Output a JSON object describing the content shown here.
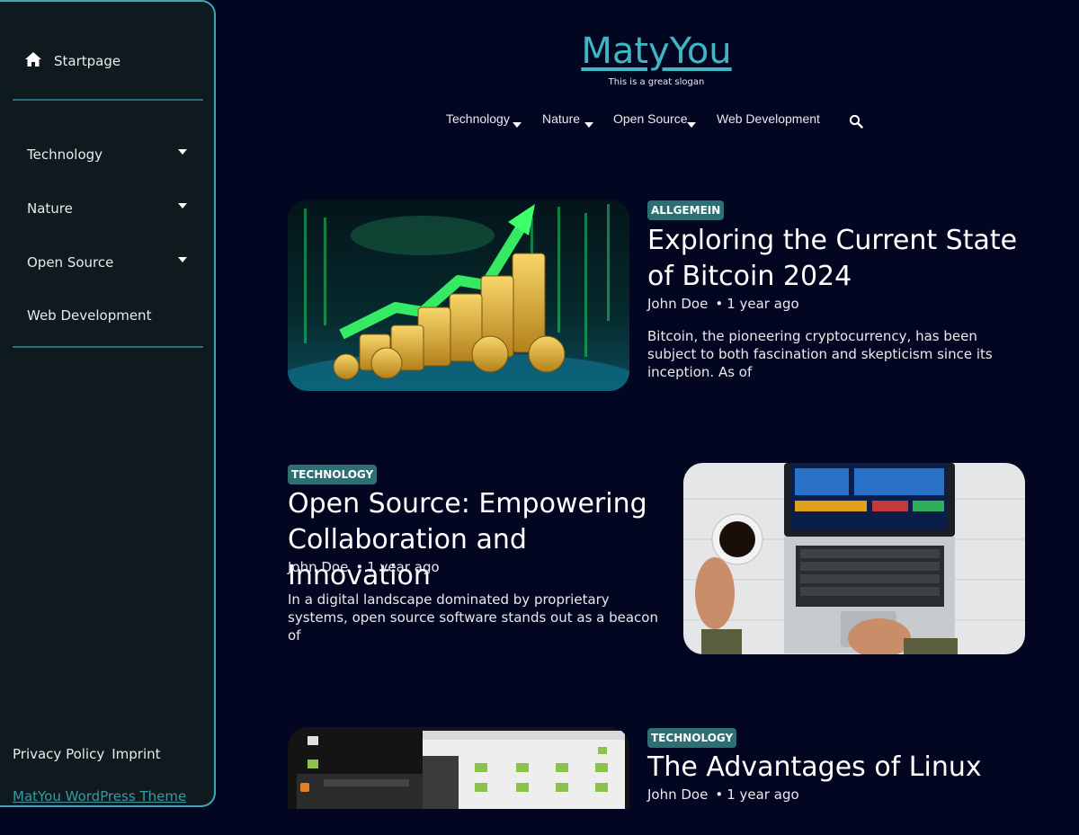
{
  "sidebar": {
    "startpage_label": "Startpage",
    "menu": [
      {
        "label": "Technology",
        "has_submenu": true
      },
      {
        "label": "Nature",
        "has_submenu": true
      },
      {
        "label": "Open Source",
        "has_submenu": true
      },
      {
        "label": "Web Development",
        "has_submenu": false
      }
    ],
    "footer_links": [
      "Privacy Policy",
      "Imprint"
    ],
    "theme_credit": "MatYou WordPress Theme"
  },
  "header": {
    "site_title": "MatyYou",
    "slogan": "This is a great slogan",
    "nav": [
      {
        "label": "Technology",
        "has_submenu": true
      },
      {
        "label": "Nature",
        "has_submenu": true
      },
      {
        "label": "Open Source",
        "has_submenu": true
      },
      {
        "label": "Web Development",
        "has_submenu": false
      }
    ],
    "search_icon": "search-icon"
  },
  "posts": [
    {
      "category": "ALLGEMEIN",
      "title": "Exploring the Current State of Bitcoin 2024",
      "author": "John Doe",
      "date": "1 year ago",
      "excerpt": "Bitcoin, the pioneering cryptocurrency, has been subject to both fascination and skepticism since its inception. As of"
    },
    {
      "category": "TECHNOLOGY",
      "title": "Open Source: Empowering Collaboration and Innovation",
      "author": "John Doe",
      "date": "1 year ago",
      "excerpt": "In a digital landscape dominated by proprietary systems, open source software stands out as a beacon of"
    },
    {
      "category": "TECHNOLOGY",
      "title": "The Advantages of Linux",
      "author": "John Doe",
      "date": "1 year ago",
      "excerpt": ""
    }
  ],
  "colors": {
    "background": "#020620",
    "sidebar": "#0f1a1f",
    "accent": "#3fb6c4",
    "badge": "#2d6f73"
  }
}
